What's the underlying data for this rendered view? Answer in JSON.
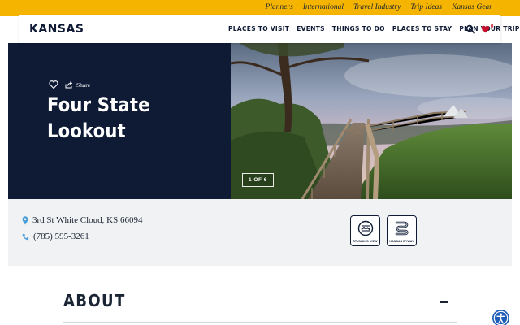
{
  "utility_nav": {
    "links": [
      "Planners",
      "International",
      "Travel Industry",
      "Trip Ideas",
      "Kansas Gear"
    ]
  },
  "header": {
    "logo": "KANSAS",
    "nav": [
      "PLACES TO VISIT",
      "EVENTS",
      "THINGS TO DO",
      "PLACES TO STAY",
      "PLAN YOUR TRIP"
    ],
    "favorites_count": "0",
    "icons": {
      "search": "search-icon",
      "favorites": "heart-icon"
    }
  },
  "hero": {
    "share_label": "Share",
    "title": "Four State Lookout",
    "gallery_counter": "1 OF 6",
    "icons": {
      "save": "heart-outline-icon",
      "share": "share-icon"
    }
  },
  "details": {
    "address": "3rd St White Cloud, KS 66094",
    "phone": "(785) 595-3261",
    "badges": [
      {
        "label": "STUNNING VIEW",
        "icon": "stunning-view-icon"
      },
      {
        "label": "KANSAS BYWAY",
        "icon": "kansas-byway-icon"
      }
    ]
  },
  "about": {
    "title": "ABOUT"
  },
  "colors": {
    "utility_bar": "#f5b400",
    "navy": "#0f1a35",
    "accent_red": "#c8102e",
    "pin_blue": "#4a9fd8",
    "info_bg": "#f1f2f3",
    "a11y_blue": "#1e5eb8"
  }
}
